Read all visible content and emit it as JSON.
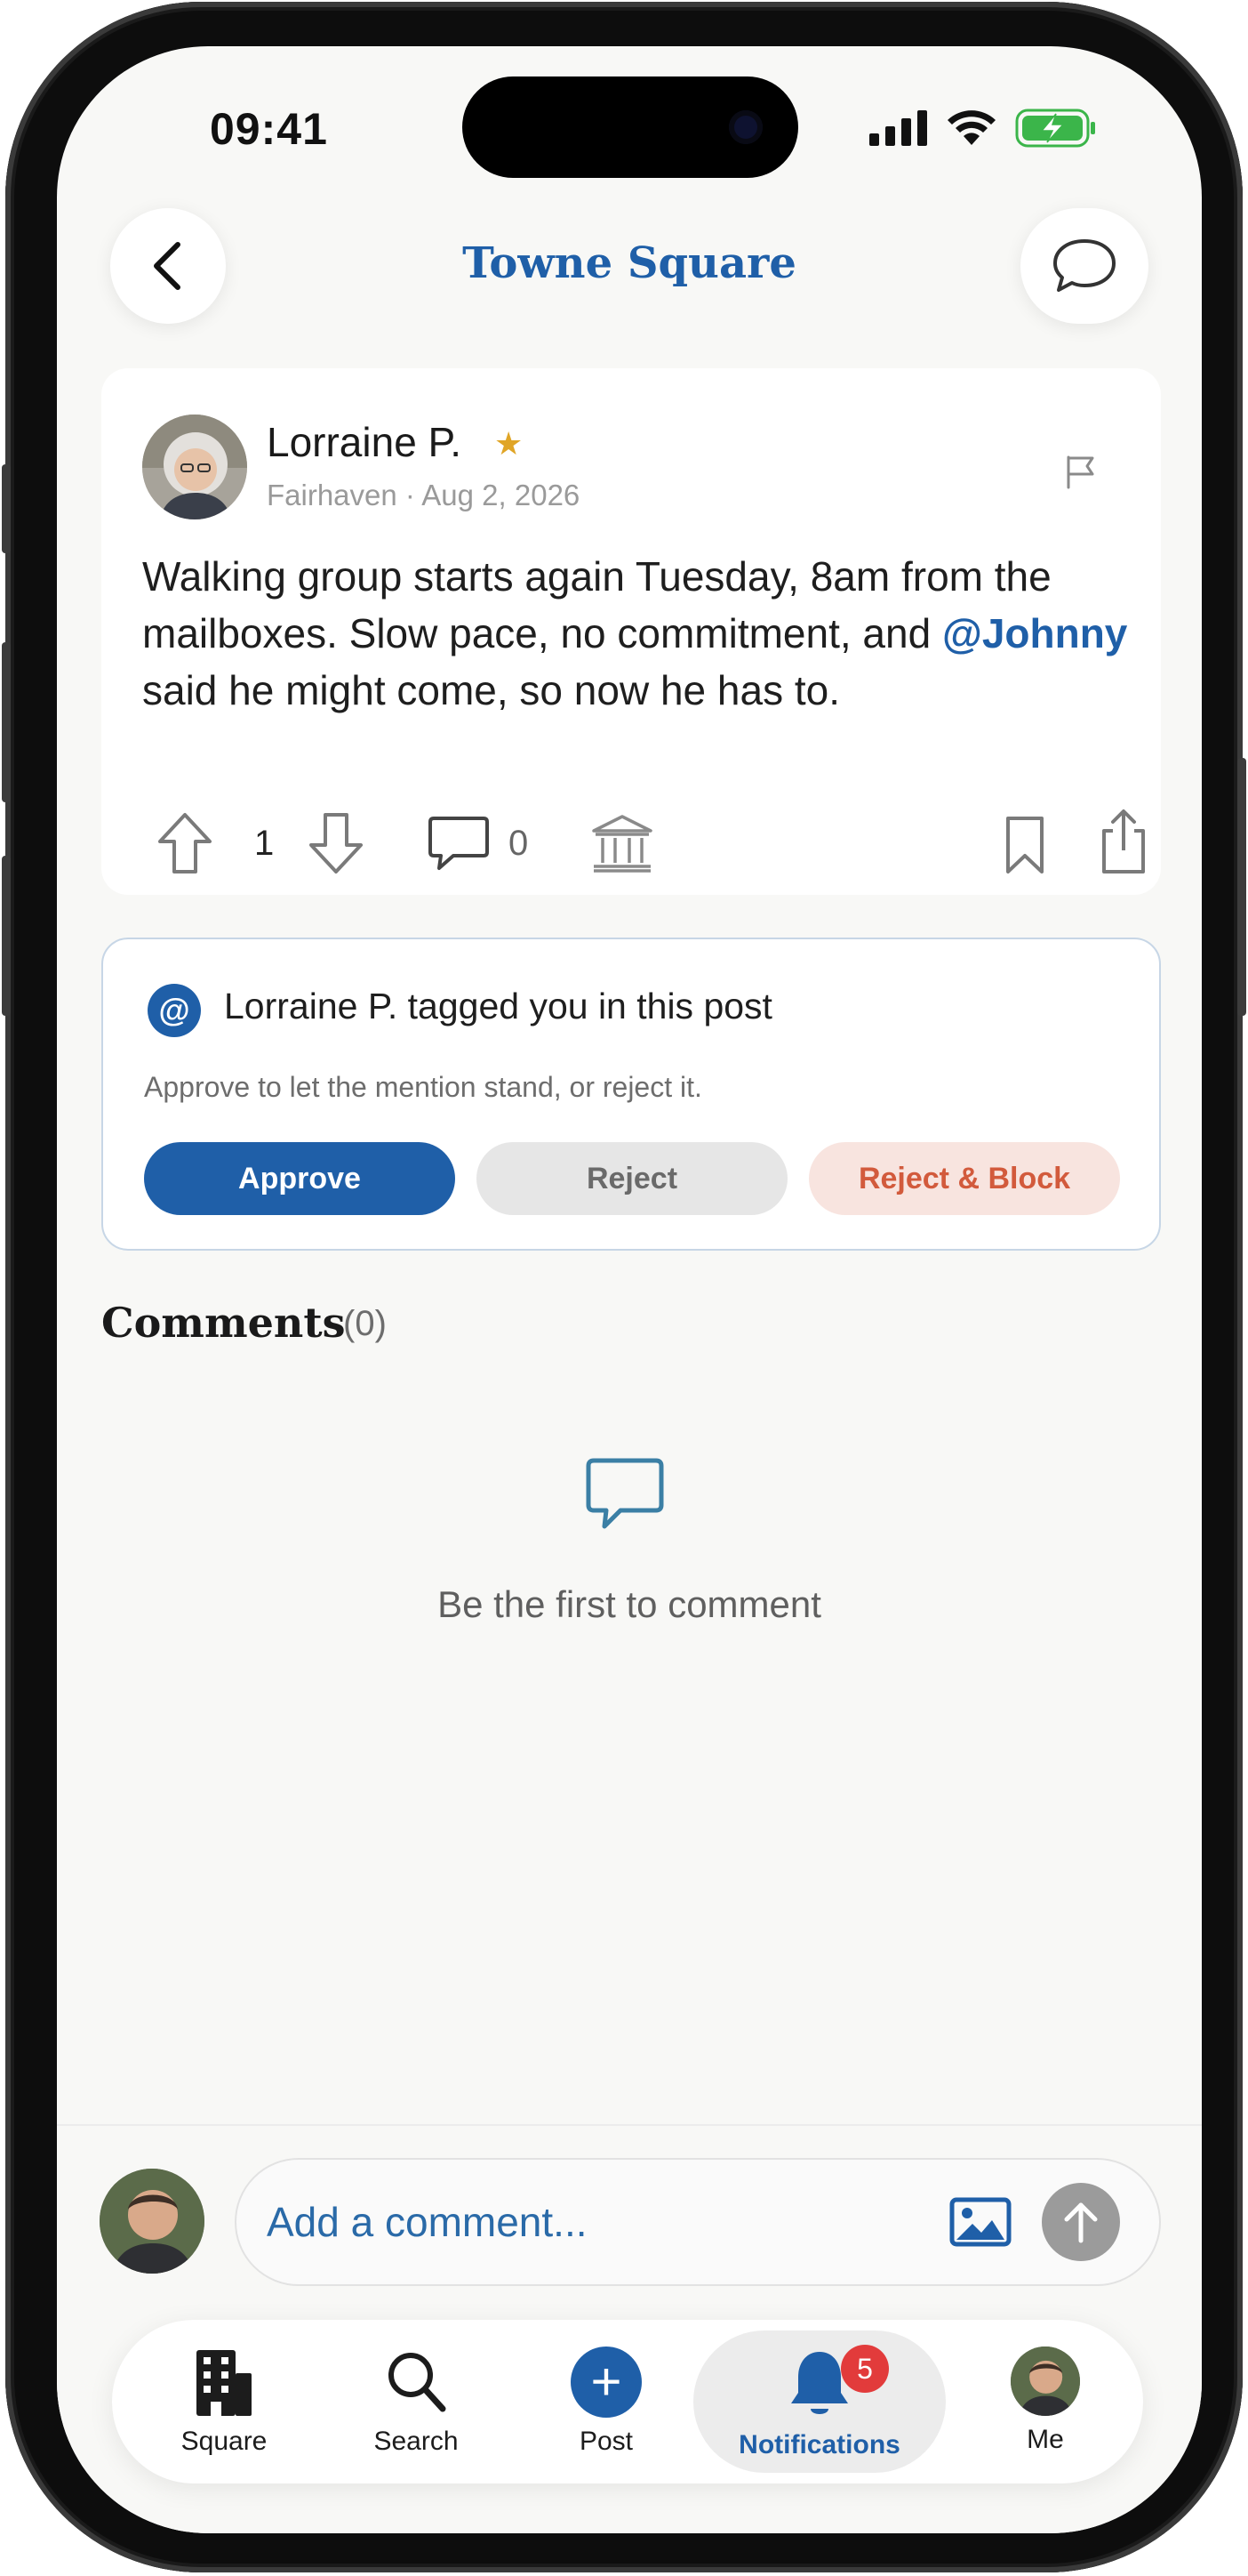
{
  "status_bar": {
    "time": "09:41"
  },
  "header": {
    "title": "Towne Square"
  },
  "post": {
    "author": "Lorraine P.",
    "location": "Fairhaven",
    "separator": "·",
    "date": "Aug 2, 2026",
    "body_part1": "Walking group starts again Tuesday, 8am from the mailboxes. Slow pace, no commitment, and ",
    "mention": "@Johnny",
    "body_part2": " said he might come, so now he has to.",
    "votes": "1",
    "comment_count": "0"
  },
  "tag_notice": {
    "icon_glyph": "@",
    "title": "Lorraine P. tagged you in this post",
    "subtitle": "Approve to let the mention stand, or reject it.",
    "approve_label": "Approve",
    "reject_label": "Reject",
    "reject_block_label": "Reject & Block"
  },
  "comments": {
    "title": "Comments",
    "count": "(0)",
    "empty_text": "Be the first to comment"
  },
  "composer": {
    "placeholder": "Add a comment..."
  },
  "tabs": [
    {
      "label": "Square",
      "icon": "building-icon"
    },
    {
      "label": "Search",
      "icon": "search-icon"
    },
    {
      "label": "Post",
      "icon": "plus-icon"
    },
    {
      "label": "Notifications",
      "icon": "bell-icon",
      "badge": "5",
      "active": true
    },
    {
      "label": "Me",
      "icon": "avatar"
    }
  ],
  "colors": {
    "brand_blue": "#1f5fa8",
    "danger": "#d25a3c",
    "badge_red": "#e23b3b",
    "star": "#e0a526"
  }
}
